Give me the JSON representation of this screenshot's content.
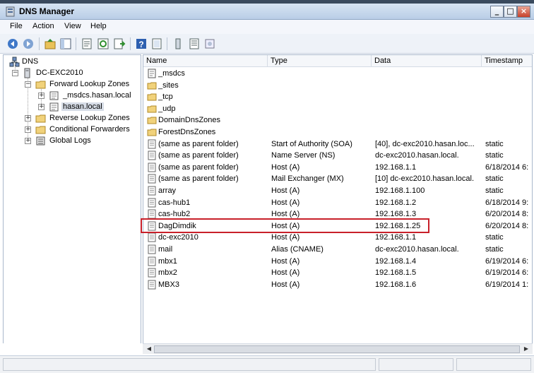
{
  "window": {
    "title": "DNS Manager"
  },
  "menu": [
    "File",
    "Action",
    "View",
    "Help"
  ],
  "toolbar_icons": [
    "back-icon",
    "forward-icon",
    "up-folder-icon",
    "show-tree-icon",
    "properties-icon",
    "refresh-icon",
    "export-list-icon",
    "help-icon",
    "server-icon",
    "list-view-icon",
    "record-icon"
  ],
  "tree": {
    "root": "DNS",
    "server": "DC-EXC2010",
    "forward_zones": "Forward Lookup Zones",
    "zone1": "_msdcs.hasan.local",
    "zone2": "hasan.local",
    "reverse_zones": "Reverse Lookup Zones",
    "conditional": "Conditional Forwarders",
    "logs": "Global Logs"
  },
  "columns": {
    "name": "Name",
    "type": "Type",
    "data": "Data",
    "timestamp": "Timestamp"
  },
  "rows": [
    {
      "icon": "folder-special-icon",
      "name": "_msdcs",
      "type": "",
      "data": "",
      "ts": ""
    },
    {
      "icon": "folder-icon",
      "name": "_sites",
      "type": "",
      "data": "",
      "ts": ""
    },
    {
      "icon": "folder-icon",
      "name": "_tcp",
      "type": "",
      "data": "",
      "ts": ""
    },
    {
      "icon": "folder-icon",
      "name": "_udp",
      "type": "",
      "data": "",
      "ts": ""
    },
    {
      "icon": "folder-icon",
      "name": "DomainDnsZones",
      "type": "",
      "data": "",
      "ts": ""
    },
    {
      "icon": "folder-icon",
      "name": "ForestDnsZones",
      "type": "",
      "data": "",
      "ts": ""
    },
    {
      "icon": "record-icon",
      "name": "(same as parent folder)",
      "type": "Start of Authority (SOA)",
      "data": "[40], dc-exc2010.hasan.loc...",
      "ts": "static"
    },
    {
      "icon": "record-icon",
      "name": "(same as parent folder)",
      "type": "Name Server (NS)",
      "data": "dc-exc2010.hasan.local.",
      "ts": "static"
    },
    {
      "icon": "record-icon",
      "name": "(same as parent folder)",
      "type": "Host (A)",
      "data": "192.168.1.1",
      "ts": "6/18/2014 6:"
    },
    {
      "icon": "record-icon",
      "name": "(same as parent folder)",
      "type": "Mail Exchanger (MX)",
      "data": "[10]  dc-exc2010.hasan.local.",
      "ts": "static"
    },
    {
      "icon": "record-icon",
      "name": "array",
      "type": "Host (A)",
      "data": "192.168.1.100",
      "ts": "static"
    },
    {
      "icon": "record-icon",
      "name": "cas-hub1",
      "type": "Host (A)",
      "data": "192.168.1.2",
      "ts": "6/18/2014 9:"
    },
    {
      "icon": "record-icon",
      "name": "cas-hub2",
      "type": "Host (A)",
      "data": "192.168.1.3",
      "ts": "6/20/2014 8:"
    },
    {
      "icon": "record-icon",
      "name": "DagDimdik",
      "type": "Host (A)",
      "data": "192.168.1.25",
      "ts": "6/20/2014 8:"
    },
    {
      "icon": "record-icon",
      "name": "dc-exc2010",
      "type": "Host (A)",
      "data": "192.168.1.1",
      "ts": "static"
    },
    {
      "icon": "record-icon",
      "name": "mail",
      "type": "Alias (CNAME)",
      "data": "dc-exc2010.hasan.local.",
      "ts": "static"
    },
    {
      "icon": "record-icon",
      "name": "mbx1",
      "type": "Host (A)",
      "data": "192.168.1.4",
      "ts": "6/19/2014 6:"
    },
    {
      "icon": "record-icon",
      "name": "mbx2",
      "type": "Host (A)",
      "data": "192.168.1.5",
      "ts": "6/19/2014 6:"
    },
    {
      "icon": "record-icon",
      "name": "MBX3",
      "type": "Host (A)",
      "data": "192.168.1.6",
      "ts": "6/19/2014 1:"
    }
  ],
  "highlight_color": "#c8202a"
}
